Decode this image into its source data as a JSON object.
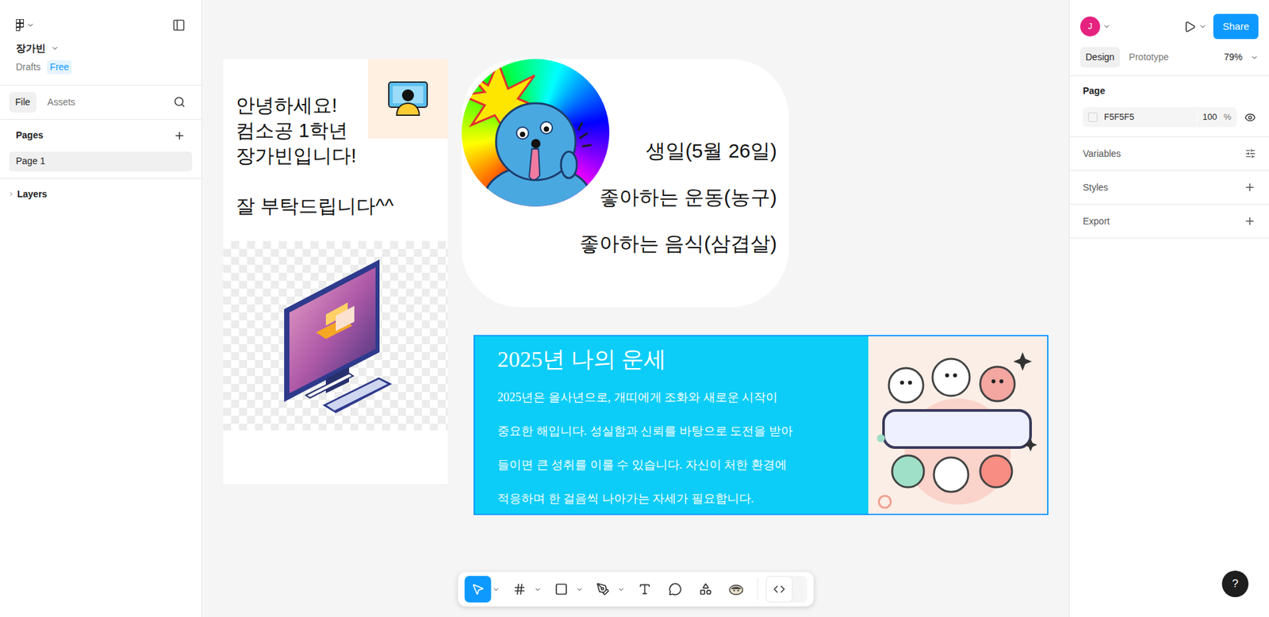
{
  "file": {
    "name": "장가빈",
    "location": "Drafts",
    "plan": "Free"
  },
  "sidebar_tabs": [
    {
      "label": "File",
      "selected": true
    },
    {
      "label": "Assets",
      "selected": false
    }
  ],
  "pages": {
    "title": "Pages",
    "items": [
      {
        "label": "Page 1",
        "selected": true
      }
    ]
  },
  "layers": {
    "title": "Layers",
    "expanded": false
  },
  "user": {
    "initial": "J"
  },
  "share": "Share",
  "panel_tabs": [
    {
      "label": "Design",
      "selected": true
    },
    {
      "label": "Prototype",
      "selected": false
    }
  ],
  "zoom": "79%",
  "page_settings": {
    "title": "Page",
    "color": "F5F5F5",
    "opacity": "100",
    "unit": "%",
    "visible": true
  },
  "sections": [
    {
      "label": "Variables",
      "kind": "settings"
    },
    {
      "label": "Styles",
      "kind": "add"
    },
    {
      "label": "Export",
      "kind": "add"
    }
  ],
  "toolbar": {
    "tools": [
      {
        "tool": "move",
        "selected": true,
        "dropdown": true
      },
      {
        "tool": "frame",
        "selected": false,
        "dropdown": true
      },
      {
        "tool": "rectangle",
        "selected": false,
        "dropdown": true
      },
      {
        "tool": "pen",
        "selected": false,
        "dropdown": true
      },
      {
        "tool": "text",
        "selected": false,
        "dropdown": false
      },
      {
        "tool": "comment",
        "selected": false,
        "dropdown": false
      },
      {
        "tool": "actions",
        "selected": false,
        "dropdown": false
      },
      {
        "tool": "ai",
        "selected": false,
        "dropdown": false
      }
    ],
    "dev_mode": false
  },
  "help": "?",
  "canvas": {
    "intro_card": {
      "greeting": [
        "안녕하세요!",
        "컴소공 1학년",
        "장가빈입니다!"
      ],
      "closing": "잘 부탁드립니다^^"
    },
    "profile_card": {
      "facts": [
        "생일(5월 26일)",
        "좋아하는 운동(농구)",
        "좋아하는 음식(삼겹살)"
      ]
    },
    "fortune_card": {
      "title": "2025년 나의 운세",
      "selected": true,
      "lines": [
        "2025년은 을사년으로, 개띠에게 조화와 새로운 시작이",
        "중요한 해입니다. 성실함과 신뢰를 바탕으로 도전을 받아",
        "들이면 큰 성취를 이룰 수 있습니다. 자신이 처한 환경에",
        "적응하며 한 걸음씩 나아가는 자세가 필요합니다."
      ]
    }
  }
}
